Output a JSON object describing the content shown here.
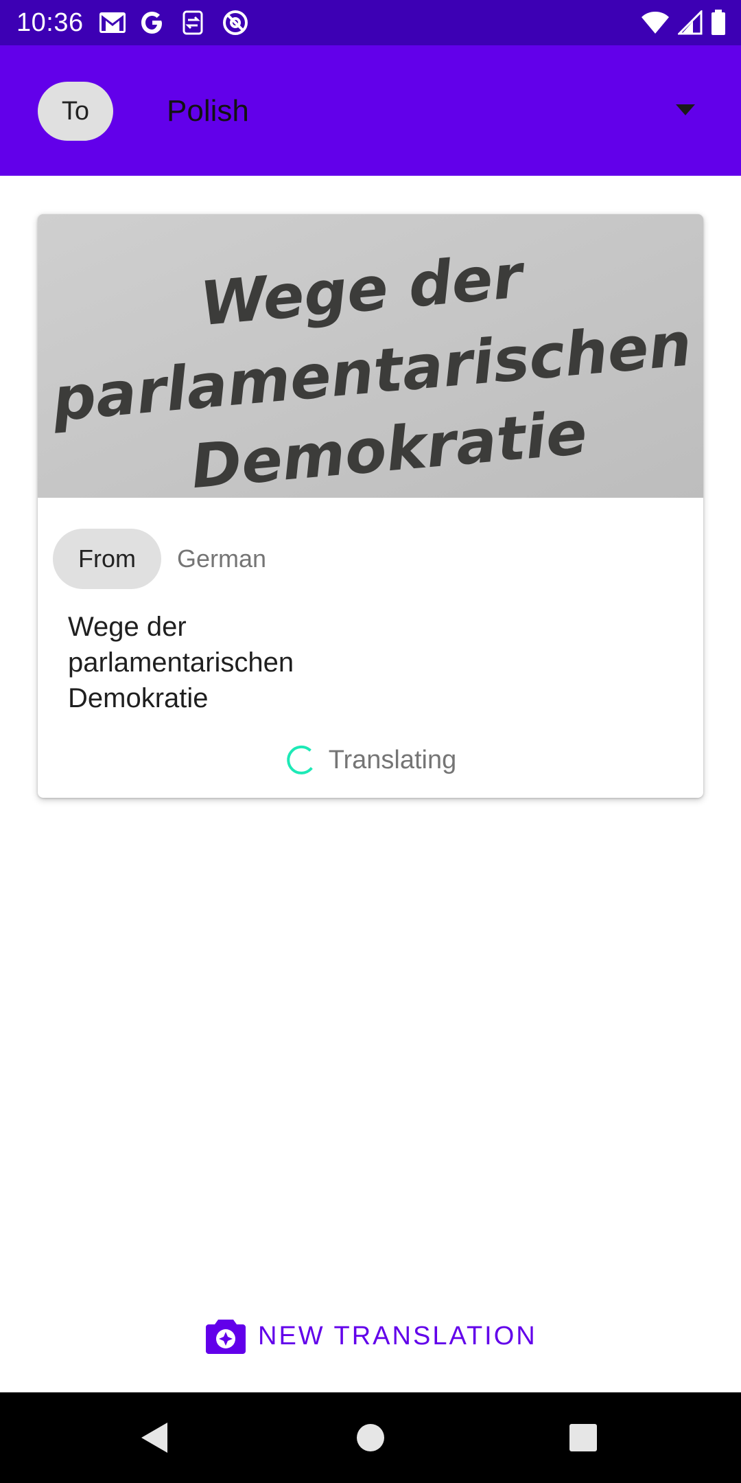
{
  "status_bar": {
    "time": "10:36",
    "left_icons": [
      "gmail-icon",
      "google-icon",
      "sync-icon",
      "blocked-at-icon"
    ],
    "right_icons": [
      "wifi-icon",
      "cell-signal-icon",
      "battery-icon"
    ]
  },
  "app_bar": {
    "to_label": "To",
    "target_language": "Polish",
    "dropdown_icon": "arrow-drop-down-icon"
  },
  "card": {
    "photo": {
      "lines": [
        "Wege der",
        "parlamentarischen",
        "Demokratie"
      ]
    },
    "from_label": "From",
    "source_language": "German",
    "source_text": "Wege der\nparlamentarischen\nDemokratie",
    "status_text": "Translating",
    "spinner_icon": "progress-spinner-icon"
  },
  "actions": {
    "new_translation_label": "NEW TRANSLATION",
    "new_translation_icon": "camera-icon"
  },
  "nav_bar": {
    "buttons": [
      "back-icon",
      "home-icon",
      "recents-icon"
    ]
  },
  "colors": {
    "status_bar": "#3d00b4",
    "app_bar": "#6200ea",
    "chip": "#e0e0e0",
    "accent": "#6200ea",
    "spinner": "#1de9b6"
  }
}
